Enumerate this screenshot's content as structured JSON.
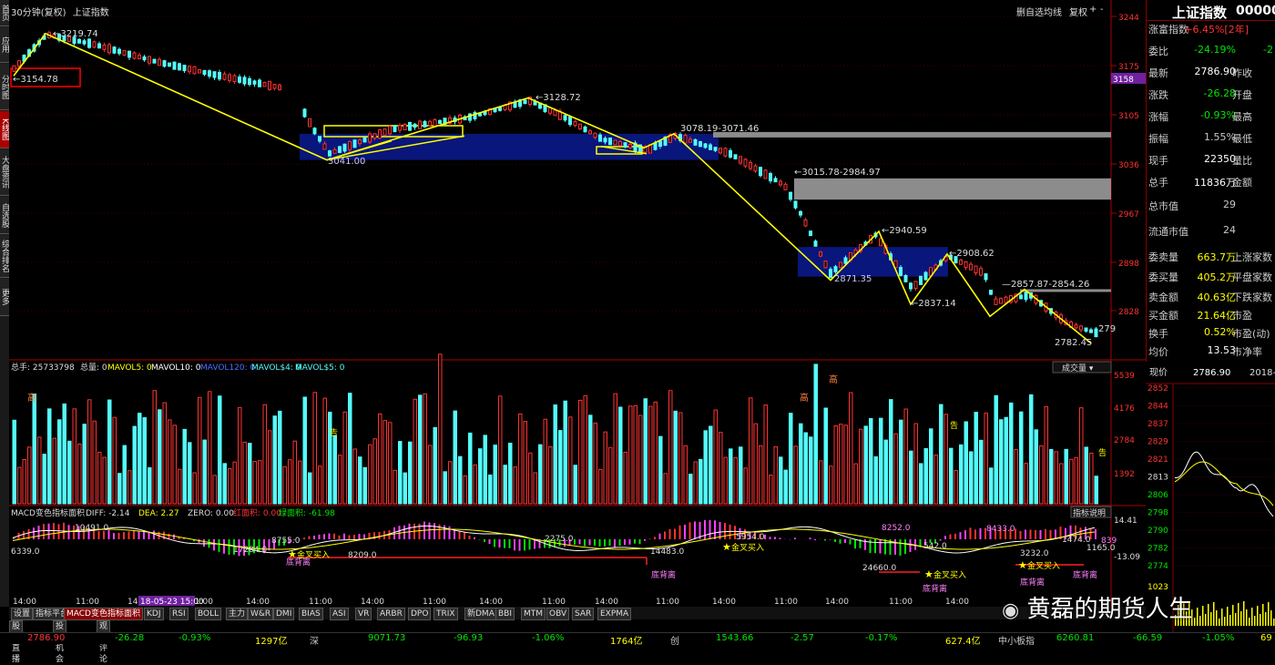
{
  "left_sidebar": [
    {
      "label": "首页",
      "active": false
    },
    {
      "label": "应用",
      "active": false
    },
    {
      "label": "分时图",
      "active": false
    },
    {
      "label": "K线图",
      "active": true
    },
    {
      "label": "大盘资讯",
      "active": false
    },
    {
      "label": "自选股",
      "active": false
    },
    {
      "label": "综合排名",
      "active": false
    },
    {
      "label": "更多",
      "active": false
    }
  ],
  "chart_header": {
    "period": "30分钟(复权)",
    "name": "上证指数"
  },
  "toolbar": [
    "删自选",
    "均线",
    "复权",
    "+",
    "-"
  ],
  "price_axis": [
    "3244",
    "3175",
    "3105",
    "3036",
    "2967",
    "2898",
    "2828"
  ],
  "price_tag": "3158",
  "annotations": {
    "high1": "3219.74",
    "low1": "3154.78",
    "high2": "3128.72",
    "low2": "3041.00",
    "gap1": "3078.19-3071.46",
    "gap2": "3015.78-2984.97",
    "high3": "2940.59",
    "low3": "2871.35",
    "high4": "2908.62",
    "low4": "2837.14",
    "gap3": "2857.87-2854.26",
    "low5": "2782.45",
    "last": "279"
  },
  "volume_header": {
    "total": "总手: 25733798",
    "zongliang": "总量: 0",
    "mavol5": "MAVOL5: 0",
    "mavol10": "MAVOL10: 0",
    "mavol120": "MAVOL120: 0",
    "mavol4": "MAVOL$4: 0",
    "mavol5b": "MAVOL$5: 0",
    "selector": "成交量"
  },
  "volume_axis": [
    "5539",
    "4176",
    "2784",
    "1392"
  ],
  "volume_marks": {
    "gao": "高",
    "ge": "告"
  },
  "macd_header": {
    "name": "MACD变色指标面积",
    "diff": "DIFF: -2.14",
    "dea": "DEA: 2.27",
    "zero": "ZERO: 0.00",
    "red": "红面积: 0.00",
    "green": "绿面积: -61.98",
    "btn": "指标说明"
  },
  "macd_axis": [
    "14.41",
    "-13.09"
  ],
  "macd_labels": {
    "v1": "10491.0",
    "v2": "6339.0",
    "v3": "17284.0",
    "v4": "8755.0",
    "v5": "8209.0",
    "v6": "2275.0",
    "v7": "14483.0",
    "v8": "5954.0",
    "v9": "8252.0",
    "v10": "542.0",
    "v11": "8433.0",
    "v12": "3232.0",
    "v13": "1165.0",
    "v14": "24660.0",
    "v15": "1474.0",
    "v16": "839",
    "jincha": "金叉买入",
    "dibeili": "底背离"
  },
  "time_axis": [
    "14:00",
    "11:00",
    "14:00",
    "11:00",
    "14:00",
    "11:00",
    "14:00",
    "11:00",
    "14:00",
    "11:00",
    "14:00",
    "11:00",
    "14:00",
    "11:00",
    "14:00",
    "11:00",
    "14:00"
  ],
  "date_tag": "18-05-23 15:00",
  "quote_panel": {
    "name": "上证指数",
    "code": "00000",
    "rows": [
      {
        "l": "涨富指数",
        "v": "+6.45%[2年]"
      },
      {
        "l": "委比",
        "v": "-24.19%",
        "v2": "-2"
      },
      {
        "l": "最新",
        "v": "2786.90",
        "l2": "昨收"
      },
      {
        "l": "涨跌",
        "v": "-26.28",
        "l2": "开盘"
      },
      {
        "l": "涨幅",
        "v": "-0.93%",
        "l2": "最高"
      },
      {
        "l": "振幅",
        "v": "1.55%",
        "l2": "最低"
      },
      {
        "l": "现手",
        "v": "22350",
        "l2": "量比"
      },
      {
        "l": "总手",
        "v": "11836万",
        "l2": "金额"
      },
      {
        "l": "总市值",
        "v": "29"
      },
      {
        "l": "流通市值",
        "v": "24"
      },
      {
        "l": "委卖量",
        "v": "663.7万",
        "l2": "上涨家数"
      },
      {
        "l": "委买量",
        "v": "405.2万",
        "l2": "平盘家数"
      },
      {
        "l": "卖金额",
        "v": "40.63亿",
        "l2": "下跌家数"
      },
      {
        "l": "买金额",
        "v": "21.64亿",
        "l2": "市盈"
      },
      {
        "l": "换手",
        "v": "0.52%",
        "l2": "市盈(动)"
      },
      {
        "l": "均价",
        "v": "13.53",
        "l2": "市净率"
      }
    ]
  },
  "mini_chart": {
    "header_l": "现价",
    "header_v": "2786.90",
    "header_d": "2018-0",
    "axis": [
      "2852",
      "2844",
      "2837",
      "2829",
      "2821",
      "2813",
      "2806",
      "2798",
      "2790",
      "2782",
      "2774"
    ],
    "vol_axis": "1023"
  },
  "indicator_tabs": [
    "设置",
    "指标平台",
    "MACD变色指标面积",
    "KDJ",
    "RSI",
    "BOLL",
    "主力",
    "W&R",
    "DMI",
    "BIAS",
    "ASI",
    "VR",
    "ARBR",
    "DPO",
    "TRIX",
    "新DMA",
    "BBI",
    "MTM",
    "OBV",
    "SAR",
    "EXPMA"
  ],
  "bottom_tabs": [
    "股市直播",
    "投资机会",
    "观点评论"
  ],
  "ticker": [
    {
      "t": "2786.90",
      "c": "#ff3232"
    },
    {
      "t": "-26.28",
      "c": "#00e600"
    },
    {
      "t": "-0.93%",
      "c": "#00e600"
    },
    {
      "t": "1297亿",
      "c": "#ffff00"
    },
    {
      "t": "深",
      "c": "#ccc"
    },
    {
      "t": "9071.73",
      "c": "#00e600"
    },
    {
      "t": "-96.93",
      "c": "#00e600"
    },
    {
      "t": "-1.06%",
      "c": "#00e600"
    },
    {
      "t": "1764亿",
      "c": "#ffff00"
    },
    {
      "t": "创",
      "c": "#ccc"
    },
    {
      "t": "1543.66",
      "c": "#00e600"
    },
    {
      "t": "-2.57",
      "c": "#00e600"
    },
    {
      "t": "-0.17%",
      "c": "#00e600"
    },
    {
      "t": "627.4亿",
      "c": "#ffff00"
    },
    {
      "t": "中小板指",
      "c": "#ccc"
    },
    {
      "t": "6260.81",
      "c": "#00e600"
    },
    {
      "t": "-66.59",
      "c": "#00e600"
    },
    {
      "t": "-1.05%",
      "c": "#00e600"
    },
    {
      "t": "69",
      "c": "#ffff00"
    }
  ],
  "watermark": "黄磊的期货人生",
  "colors": {
    "up": "#ff3232",
    "down": "#54fcfc",
    "zigzag": "#ffff00",
    "box": "#1a2aa8",
    "gap": "#8c8c8c"
  }
}
